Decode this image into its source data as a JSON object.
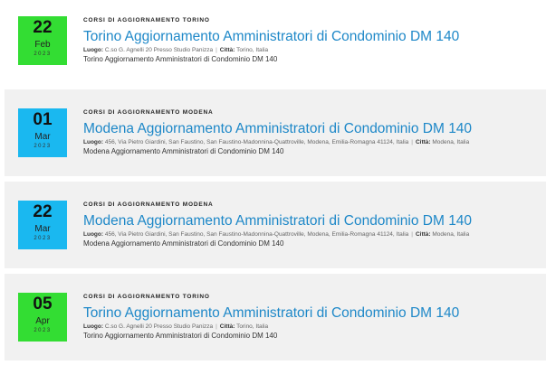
{
  "events": [
    {
      "day": "22",
      "month": "Feb",
      "year": "2023",
      "category": "CORSI DI AGGIORNAMENTO TORINO",
      "title": "Torino Aggiornamento Amministratori di Condominio DM 140",
      "luogo_label": "Luogo:",
      "luogo": "C.so G. Agnelli 20 Presso Studio Panizza",
      "separator": "|",
      "citta_label": "Città:",
      "citta": "Torino, Italia",
      "description": "Torino Aggiornamento Amministratori di Condominio DM 140",
      "color": "#33dd33"
    },
    {
      "day": "01",
      "month": "Mar",
      "year": "2023",
      "category": "CORSI DI AGGIORNAMENTO MODENA",
      "title": "Modena Aggiornamento Amministratori di Condominio DM 140",
      "luogo_label": "Luogo:",
      "luogo": "456, Via Pietro Giardini, San Faustino, San Faustino-Madonnina-Quattroville, Modena, Emilia-Romagna 41124, Italia",
      "separator": "|",
      "citta_label": "Città:",
      "citta": "Modena, Italia",
      "description": "Modena Aggiornamento Amministratori di Condominio DM 140",
      "color": "#1ab8f0"
    },
    {
      "day": "22",
      "month": "Mar",
      "year": "2023",
      "category": "CORSI DI AGGIORNAMENTO MODENA",
      "title": "Modena Aggiornamento Amministratori di Condominio DM 140",
      "luogo_label": "Luogo:",
      "luogo": "456, Via Pietro Giardini, San Faustino, San Faustino-Madonnina-Quattroville, Modena, Emilia-Romagna 41124, Italia",
      "separator": "|",
      "citta_label": "Città:",
      "citta": "Modena, Italia",
      "description": "Modena Aggiornamento Amministratori di Condominio DM 140",
      "color": "#1ab8f0"
    },
    {
      "day": "05",
      "month": "Apr",
      "year": "2023",
      "category": "CORSI DI AGGIORNAMENTO TORINO",
      "title": "Torino Aggiornamento Amministratori di Condominio DM 140",
      "luogo_label": "Luogo:",
      "luogo": "C.so G. Agnelli 20 Presso Studio Panizza",
      "separator": "|",
      "citta_label": "Città:",
      "citta": "Torino, Italia",
      "description": "Torino Aggiornamento Amministratori di Condominio DM 140",
      "color": "#33dd33"
    }
  ]
}
